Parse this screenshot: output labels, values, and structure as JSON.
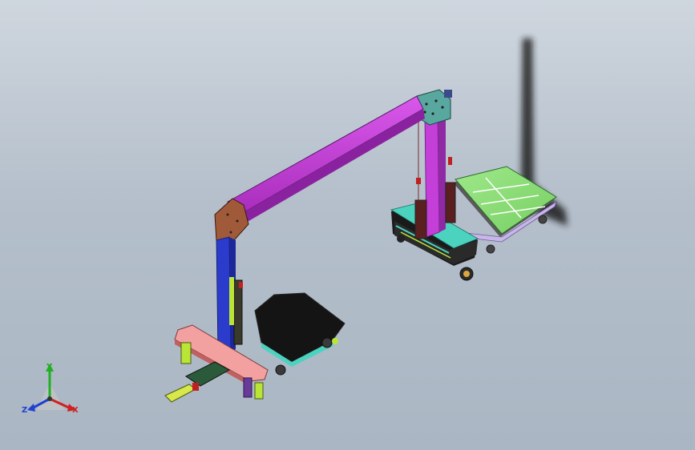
{
  "viewport": {
    "background_top": "#cfd6de",
    "background_bottom": "#aab6c3"
  },
  "model": {
    "beam_color": "#c43ed8",
    "column_color": "#2b3bcc",
    "right_column_color": "#c43ed8",
    "green_platform_color": "#8ee07a",
    "black_platform_color": "#141414",
    "pink_beam_color": "#f2a0a0",
    "cyan_base_color": "#4bd3bf",
    "yellow_green_color": "#b9e636"
  },
  "triad": {
    "x_label": "X",
    "y_label": "Y",
    "z_label": "Z",
    "x_color": "#d02020",
    "y_color": "#20b020",
    "z_color": "#2040d0"
  }
}
